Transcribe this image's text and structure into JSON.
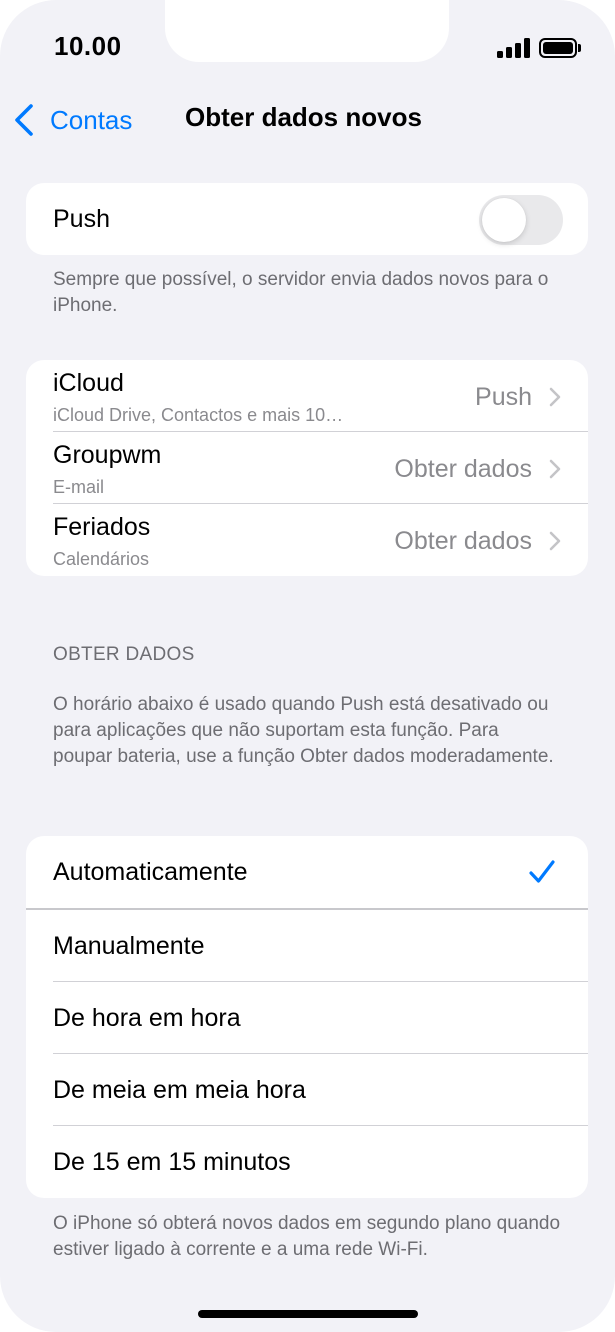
{
  "status_bar": {
    "time": "10.00"
  },
  "nav": {
    "back_label": "Contas",
    "title": "Obter dados novos"
  },
  "push": {
    "label": "Push",
    "enabled": false,
    "footnote": "Sempre que possível, o servidor envia dados novos para o iPhone."
  },
  "accounts": [
    {
      "name": "iCloud",
      "subtitle": "iCloud Drive, Contactos e mais 10…",
      "value": "Push"
    },
    {
      "name": "Groupwm",
      "subtitle": "E-mail",
      "value": "Obter dados"
    },
    {
      "name": "Feriados",
      "subtitle": "Calendários",
      "value": "Obter dados"
    }
  ],
  "fetch": {
    "header": "OBTER DADOS",
    "description": "O horário abaixo é usado quando Push está desativado ou para aplicações que não suportam esta função. Para poupar bateria, use a função Obter dados moderadamente.",
    "options": [
      {
        "label": "Automaticamente",
        "selected": true
      },
      {
        "label": "Manualmente",
        "selected": false
      },
      {
        "label": "De hora em hora",
        "selected": false
      },
      {
        "label": "De meia em meia hora",
        "selected": false
      },
      {
        "label": "De 15 em 15 minutos",
        "selected": false
      }
    ],
    "footnote": "O iPhone só obterá novos dados em segundo plano quando estiver ligado à corrente e a uma rede Wi-Fi."
  },
  "colors": {
    "accent": "#007aff",
    "background": "#f2f2f7",
    "secondary_text": "#8a8a8e"
  },
  "icons": {
    "back": "chevron-left-icon",
    "disclosure": "chevron-right-icon",
    "selected": "checkmark-icon"
  }
}
